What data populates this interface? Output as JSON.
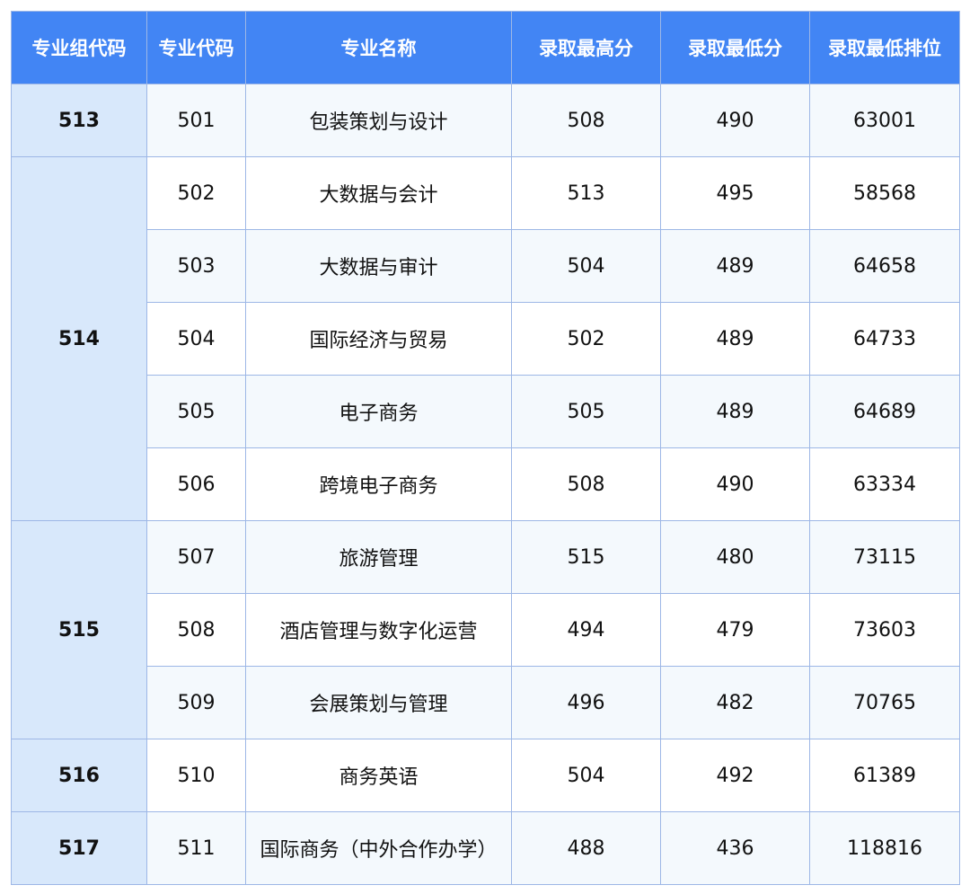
{
  "table": {
    "headers": [
      "专业组代码",
      "专业代码",
      "专业名称",
      "录取最高分",
      "录取最低分",
      "录取最低排位"
    ],
    "groups": [
      {
        "code": "513",
        "rows": [
          {
            "major_code": "501",
            "name": "包装策划与设计",
            "max": "508",
            "min": "490",
            "rank": "63001"
          }
        ]
      },
      {
        "code": "514",
        "rows": [
          {
            "major_code": "502",
            "name": "大数据与会计",
            "max": "513",
            "min": "495",
            "rank": "58568"
          },
          {
            "major_code": "503",
            "name": "大数据与审计",
            "max": "504",
            "min": "489",
            "rank": "64658"
          },
          {
            "major_code": "504",
            "name": "国际经济与贸易",
            "max": "502",
            "min": "489",
            "rank": "64733"
          },
          {
            "major_code": "505",
            "name": "电子商务",
            "max": "505",
            "min": "489",
            "rank": "64689"
          },
          {
            "major_code": "506",
            "name": "跨境电子商务",
            "max": "508",
            "min": "490",
            "rank": "63334"
          }
        ]
      },
      {
        "code": "515",
        "rows": [
          {
            "major_code": "507",
            "name": "旅游管理",
            "max": "515",
            "min": "480",
            "rank": "73115"
          },
          {
            "major_code": "508",
            "name": "酒店管理与数字化运营",
            "max": "494",
            "min": "479",
            "rank": "73603"
          },
          {
            "major_code": "509",
            "name": "会展策划与管理",
            "max": "496",
            "min": "482",
            "rank": "70765"
          }
        ]
      },
      {
        "code": "516",
        "rows": [
          {
            "major_code": "510",
            "name": "商务英语",
            "max": "504",
            "min": "492",
            "rank": "61389"
          }
        ]
      },
      {
        "code": "517",
        "rows": [
          {
            "major_code": "511",
            "name": "国际商务（中外合作办学）",
            "max": "488",
            "min": "436",
            "rank": "118816"
          }
        ]
      }
    ]
  }
}
